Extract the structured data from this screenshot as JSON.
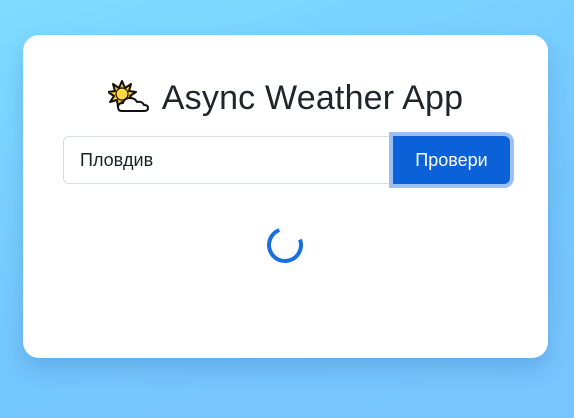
{
  "app": {
    "title": "Async Weather App",
    "title_icon": "sun-behind-cloud-icon"
  },
  "search": {
    "city_value": "Пловдив",
    "button_label": "Провери"
  },
  "status": {
    "loading": true,
    "spinner_icon": "loading-spinner-icon"
  },
  "colors": {
    "accent": "#0b62d8",
    "spinner": "#1a6fe0",
    "background_start": "#7fdcff",
    "background_end": "#74c6ff"
  }
}
